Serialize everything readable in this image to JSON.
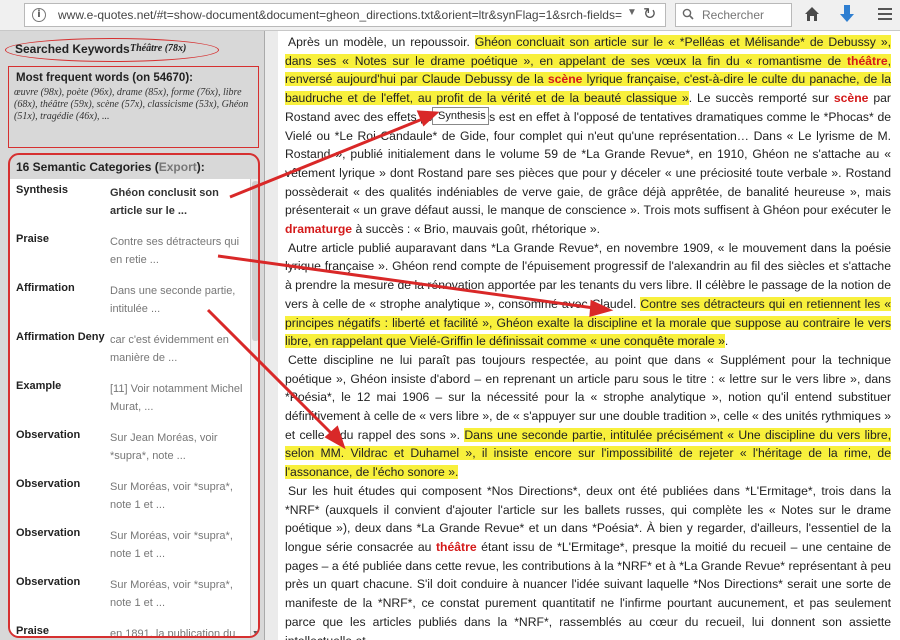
{
  "browser": {
    "url": "www.e-quotes.net/#t=show-document&document=gheon_directions.txt&orient=ltr&synFlag=1&srch-fields=[{\"jav",
    "search_placeholder": "Rechercher"
  },
  "keywords": {
    "title": "Searched Keywords",
    "value": "Théâtre (78x)"
  },
  "frequent": {
    "title": "Most frequent words (on 54670):",
    "words": "œuvre (98x), poète (96x), drame (85x), forme (76x), libre (68x), théâtre (59x), scène (57x), classicisme (53x), Ghéon (51x), tragédie (46x), ..."
  },
  "categories": {
    "count_label": "16 Semantic Categories (",
    "export_label": "Export",
    "close_label": "):",
    "items": [
      {
        "name": "Synthesis",
        "snippet": "Ghéon conclusit son article sur le ..."
      },
      {
        "name": "Praise",
        "snippet": "Contre ses détracteurs qui en retie ..."
      },
      {
        "name": "Affirmation",
        "snippet": "Dans une seconde partie, intitulée ..."
      },
      {
        "name": "Affirmation Deny",
        "snippet": "car c'est évidemment en manière de ..."
      },
      {
        "name": "Example",
        "snippet": "[11] Voir notamment Michel Murat, ..."
      },
      {
        "name": "Observation",
        "snippet": "Sur Jean Moréas, voir *supra*, note ..."
      },
      {
        "name": "Observation",
        "snippet": "Sur Moréas, voir *supra*, note 1 et ..."
      },
      {
        "name": "Observation",
        "snippet": "Sur Moréas, voir *supra*, note 1 et ..."
      },
      {
        "name": "Observation",
        "snippet": "Sur Moréas, voir *supra*, note 1 et ..."
      },
      {
        "name": "Praise",
        "snippet": "en 1891, la publication du"
      }
    ]
  },
  "tooltip": "Synthesis",
  "document": {
    "p1": {
      "a": "Après un modèle, un repoussoir. ",
      "b": "Ghéon concluait son article sur le « *Pelléas et Mélisande* de Debussy », dans ses « Notes sur le drame poétique », en appelant de ses vœux la fin du « romantisme de ",
      "kw1": "théâtre",
      "c": ", renversé aujourd'hui par Claude Debussy de la ",
      "kw2": "scène",
      "d": " lyrique française, c'est-à-dire le culte du panache, de la baudruche et de l'effet, au profit de la vérité et de la beauté classique »",
      "e": ". Le succès remporté sur ",
      "kw3": "scène",
      "f": " par Rostand avec des effets parfois faciles est en effet à l'opposé de tentatives dramatiques comme le *Phocas* de Vielé ou *Le Roi Candaule* de Gide, four complet qui n'eut qu'une représentation… Dans « Le lyrisme de M. Rostand », publié initialement dans le volume 59 de *La Grande Revue*, en 1910, Ghéon ne s'attache au « vêtement lyrique » dont Rostand pare ses pièces que pour y déceler « une préciosité toute verbale ». Rostand possèderait « des qualités indéniables de verve gaie, de grâce déjà apprêtée, de banalité heureuse », mais présenterait « un grave défaut aussi, le manque de conscience ». Trois mots suffisent à Ghéon pour exécuter le ",
      "kw4": "dramaturge",
      "g": " à succès : « Brio, mauvais goût, rhétorique »."
    },
    "p2": {
      "a": "Autre article publié auparavant dans *La Grande Revue*, en novembre 1909, « le mouvement dans la poésie lyrique française ». Ghéon rend compte de l'épuisement progressif de l'alexandrin au fil des siècles et s'attache à prendre la mesure de la rénovation apportée par les tenants du vers libre. Il célèbre le passage de la notion de vers à celle de « strophe analytique », consommé avec Claudel. ",
      "b": "Contre ses détracteurs qui en retiennent les « principes négatifs : liberté et facilité », Ghéon exalte la discipline et la morale que suppose au contraire le vers libre, en rappelant que Vielé-Griffin le définissait comme « une conquête morale »",
      "c": "."
    },
    "p3": {
      "a": "Cette discipline ne lui paraît pas toujours respectée, au point que dans « Supplément pour la technique poétique », Ghéon insiste d'abord – en reprenant un article paru sous le titre : « lettre sur le vers libre », dans *Poésia*, le 12 mai 1906 – sur la nécessité pour la « strophe analytique », notion qu'il entend substituer définitivement à celle de « vers libre », de « s'appuyer sur une double tradition », celle « des unités rythmiques » et celle « du rappel des sons ». ",
      "b": "Dans une seconde partie, intitulée précisément « Une discipline du vers libre, selon MM. Vildrac et Duhamel », il insiste encore sur l'impossibilité de rejeter « l'héritage de la rime, de l'assonance, de l'écho sonore »."
    },
    "p4": {
      "a": "Sur les huit études qui composent *Nos Directions*, deux ont été publiées dans *L'Ermitage*, trois dans la *NRF* (auxquels il convient d'ajouter l'article sur les ballets russes, qui complète les « Notes sur le drame poétique »), deux dans *La Grande Revue* et un dans *Poésia*. À bien y regarder, d'ailleurs, l'essentiel de la longue série consacrée au ",
      "kw1": "théâtre",
      "b": " étant issu de *L'Ermitage*, presque la moitié du recueil – une centaine de pages – a été publiée dans cette revue, les contributions à la *NRF* et à *La Grande Revue* représentant à peu près un quart chacune. S'il doit conduire à nuancer l'idée suivant laquelle *Nos Directions* serait une sorte de manifeste de la *NRF*, ce constat purement quantitatif ne l'infirme pourtant aucunement, et pas seulement parce que les articles publiés dans la *NRF*, rassemblés au cœur du recueil, lui donnent son assiette intellectuelle et"
    }
  }
}
